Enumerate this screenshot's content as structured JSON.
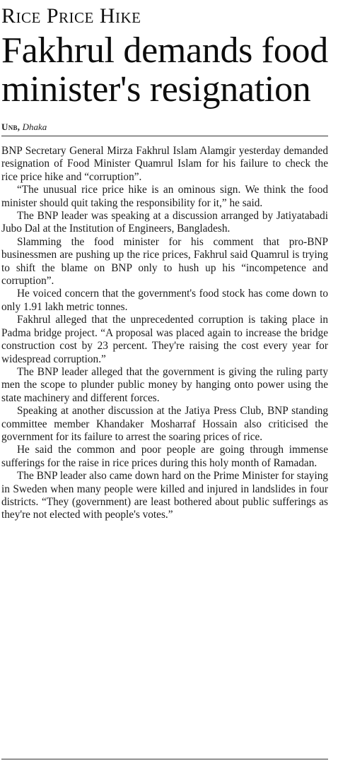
{
  "article": {
    "kicker": "Rice Price Hike",
    "headline": "Fakhrul demands food minister's resignation",
    "byline": {
      "agency": "Unb,",
      "place": "Dhaka"
    },
    "paragraphs": [
      "BNP Secretary General Mirza Fakhrul Islam Alamgir yesterday demanded resignation of Food Minister Quamrul Islam for his failure to check the rice price hike and “corruption”.",
      "“The unusual rice price hike is an ominous sign. We think the food minister should quit taking the responsibility for it,” he said.",
      "The BNP leader was speaking at a discussion arranged by Jatiyatabadi Jubo Dal at the Institution of Engineers, Bangladesh.",
      "Slamming the food minister for his comment that pro-BNP businessmen are pushing up the rice prices, Fakhrul said Quamrul is trying to shift the blame on BNP only to hush up his “incompetence and corruption”.",
      "He voiced concern that the government's food stock has come down to only 1.91 lakh metric tonnes.",
      "Fakhrul alleged that the unprecedented corruption is taking place in Padma bridge project. “A proposal was placed again to increase the bridge construction cost by 23 percent. They're raising the cost every year for widespread corruption.”",
      "The BNP leader alleged that the government is giving the ruling party men the scope to plunder public money by hanging onto power using the state machinery and different forces.",
      "Speaking at another discussion at the Jatiya Press Club, BNP standing committee member Khandaker Mosharraf Hossain also criticised the government for its failure to arrest the soaring prices of rice.",
      "He said the common and poor people are going through immense sufferings for the raise in rice prices during this holy month of Ramadan.",
      "The BNP leader also came down hard on the Prime Minister for staying in Sweden when many people were killed and injured in landslides in four districts. “They (government) are least bothered about public sufferings as they're not elected with people's votes.”"
    ]
  }
}
